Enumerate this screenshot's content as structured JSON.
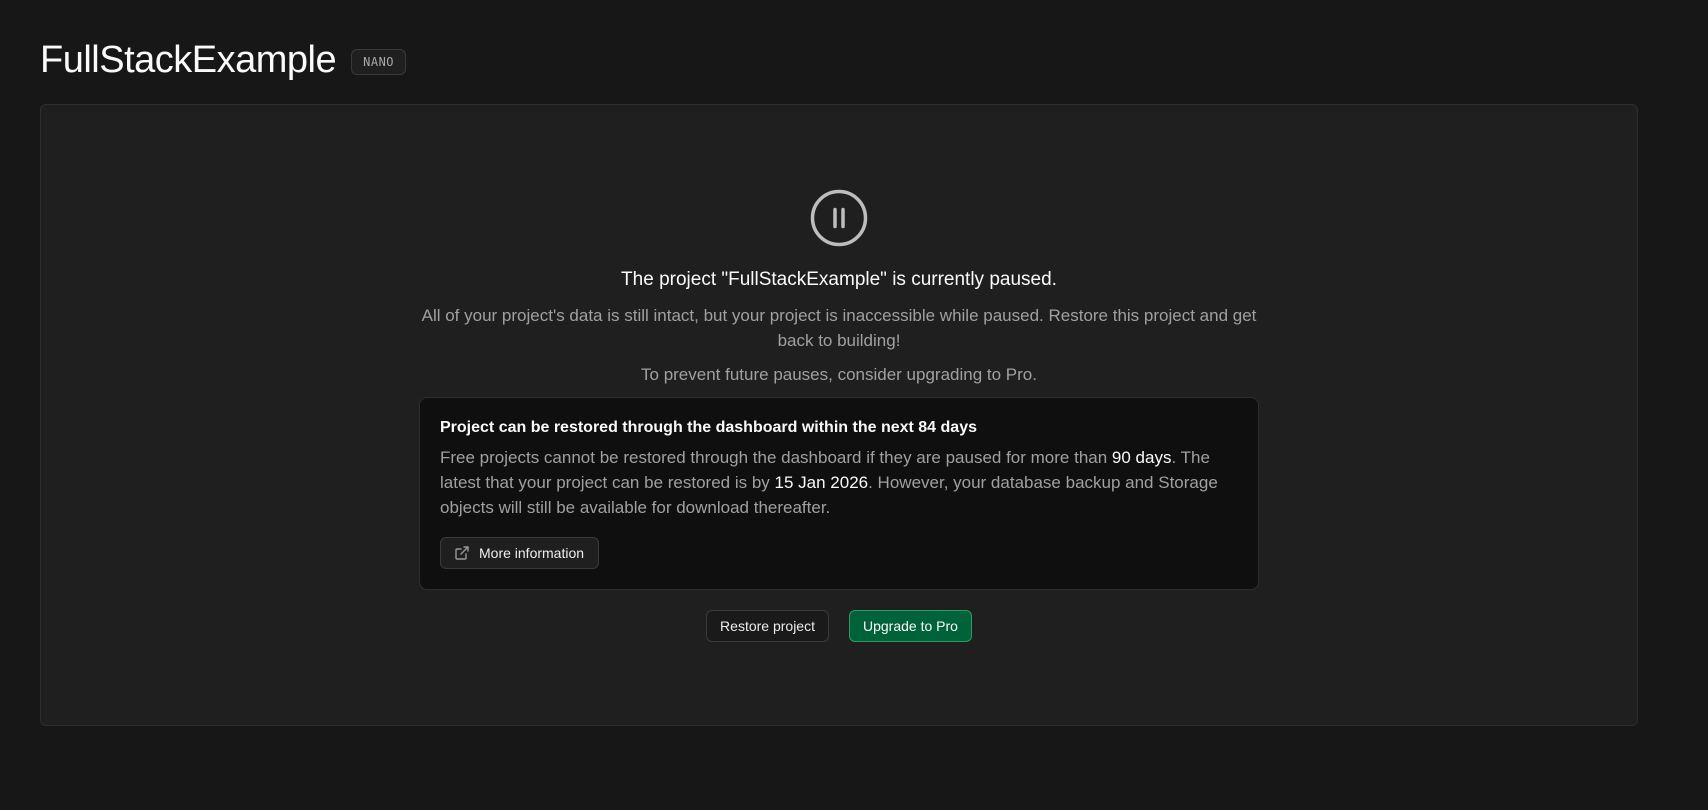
{
  "header": {
    "project_name": "FullStackExample",
    "plan_badge": "NANO"
  },
  "paused": {
    "icon": "pause-circle-icon",
    "heading": "The project \"FullStackExample\" is currently paused.",
    "description": "All of your project's data is still intact, but your project is inaccessible while paused. Restore this project and get back to building!",
    "upgrade_hint": "To prevent future pauses, consider upgrading to Pro."
  },
  "notice": {
    "title": "Project can be restored through the dashboard within the next 84 days",
    "body_part1": "Free projects cannot be restored through the dashboard if they are paused for more than ",
    "days_limit": "90 days",
    "body_part2": ". The latest that your project can be restored is by ",
    "restore_by_date": "15 Jan 2026",
    "body_part3": ". However, your database backup and Storage objects will still be available for download thereafter.",
    "more_info_label": "More information",
    "more_info_icon": "external-link-icon"
  },
  "actions": {
    "restore_label": "Restore project",
    "upgrade_label": "Upgrade to Pro"
  },
  "colors": {
    "background": "#171717",
    "panel": "#1f1f1f",
    "notice_bg": "#0f0f0f",
    "primary_green": "#006239",
    "primary_border": "#2f9b63"
  }
}
